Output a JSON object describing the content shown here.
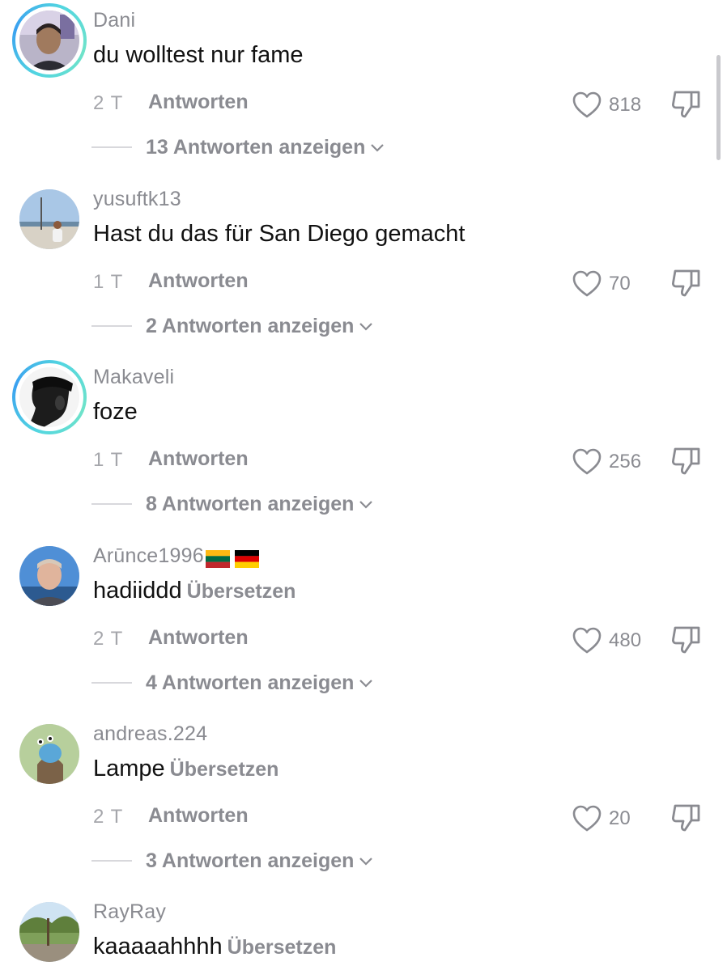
{
  "comments": [
    {
      "username": "Dani",
      "text": "du wolltest nur fame",
      "time": "2 T",
      "reply_label": "Antworten",
      "likes": "818",
      "view_replies": "13 Antworten anzeigen",
      "story_ring": true
    },
    {
      "username": "yusuftk13",
      "text": "Hast du das für San Diego gemacht",
      "time": "1 T",
      "reply_label": "Antworten",
      "likes": "70",
      "view_replies": "2 Antworten anzeigen",
      "story_ring": false
    },
    {
      "username": "Makaveli",
      "text": "foze",
      "time": "1 T",
      "reply_label": "Antworten",
      "likes": "256",
      "view_replies": "8 Antworten anzeigen",
      "story_ring": true
    },
    {
      "username": "Arūnce1996",
      "username_flags": [
        "lithuania-flag",
        "germany-flag"
      ],
      "text": "hadiiddd",
      "translate_label": "Übersetzen",
      "time": "2 T",
      "reply_label": "Antworten",
      "likes": "480",
      "view_replies": "4 Antworten anzeigen",
      "story_ring": false
    },
    {
      "username": "andreas.224",
      "text": "Lampe",
      "translate_label": "Übersetzen",
      "time": "2 T",
      "reply_label": "Antworten",
      "likes": "20",
      "view_replies": "3 Antworten anzeigen",
      "story_ring": false
    },
    {
      "username": "RayRay",
      "text": "kaaaaahhhh",
      "translate_label": "Übersetzen",
      "story_ring": false
    }
  ],
  "icons": {
    "like": "heart-outline-icon",
    "dislike": "thumbs-down-icon",
    "expand": "chevron-down-icon"
  },
  "colors": {
    "text_primary": "#111111",
    "text_secondary": "#8a8b91",
    "story_ring": "#53d6e0"
  }
}
